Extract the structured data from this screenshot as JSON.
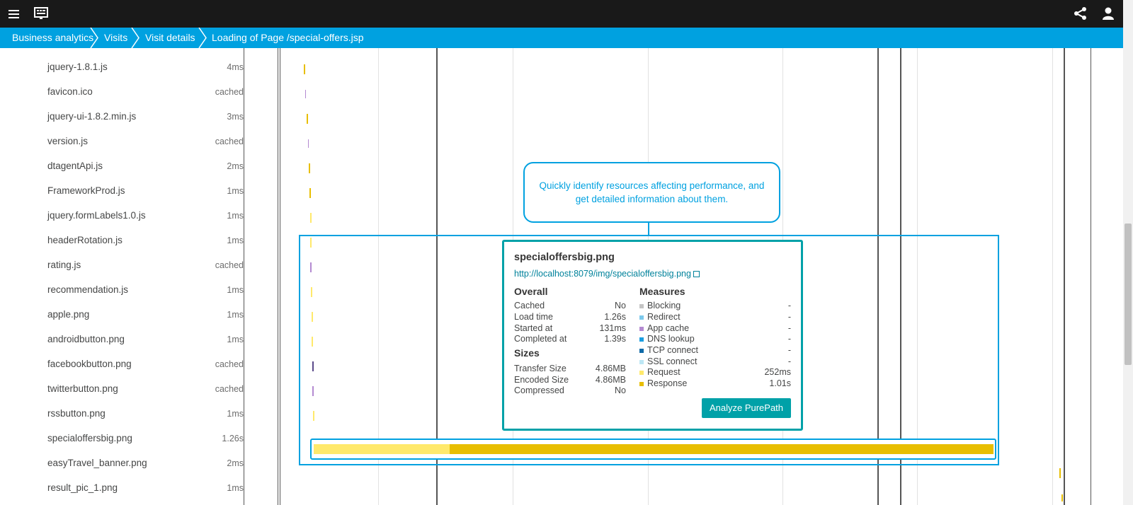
{
  "topbar": {
    "menu_icon": "hamburger-icon",
    "monitor_icon": "monitor-icon",
    "share_icon": "share-icon",
    "user_icon": "user-icon"
  },
  "breadcrumb": [
    {
      "label": "Business analytics"
    },
    {
      "label": "Visits"
    },
    {
      "label": "Visit details"
    },
    {
      "label": "Loading of Page /special-offers.jsp"
    }
  ],
  "resources": [
    {
      "name": "jquery-1.8.1.js",
      "duration": "4ms"
    },
    {
      "name": "favicon.ico",
      "duration": "cached"
    },
    {
      "name": "jquery-ui-1.8.2.min.js",
      "duration": "3ms"
    },
    {
      "name": "version.js",
      "duration": "cached"
    },
    {
      "name": "dtagentApi.js",
      "duration": "2ms"
    },
    {
      "name": "FrameworkProd.js",
      "duration": "1ms"
    },
    {
      "name": "jquery.formLabels1.0.js",
      "duration": "1ms"
    },
    {
      "name": "headerRotation.js",
      "duration": "1ms"
    },
    {
      "name": "rating.js",
      "duration": "cached"
    },
    {
      "name": "recommendation.js",
      "duration": "1ms"
    },
    {
      "name": "apple.png",
      "duration": "1ms"
    },
    {
      "name": "androidbutton.png",
      "duration": "1ms"
    },
    {
      "name": "facebookbutton.png",
      "duration": "cached"
    },
    {
      "name": "twitterbutton.png",
      "duration": "cached"
    },
    {
      "name": "rssbutton.png",
      "duration": "1ms"
    },
    {
      "name": "specialoffersbig.png",
      "duration": "1.26s"
    },
    {
      "name": "easyTravel_banner.png",
      "duration": "2ms"
    },
    {
      "name": "result_pic_1.png",
      "duration": "1ms"
    }
  ],
  "callout": {
    "line1": "Quickly identify resources affecting performance, and",
    "line2": "get detailed information about them."
  },
  "details": {
    "title": "specialoffersbig.png",
    "url": "http://localhost:8079/img/specialoffersbig.png",
    "overall_heading": "Overall",
    "overall": [
      {
        "label": "Cached",
        "value": "No"
      },
      {
        "label": "Load time",
        "value": "1.26s"
      },
      {
        "label": "Started at",
        "value": "131ms"
      },
      {
        "label": "Completed at",
        "value": "1.39s"
      }
    ],
    "sizes_heading": "Sizes",
    "sizes": [
      {
        "label": "Transfer Size",
        "value": "4.86MB"
      },
      {
        "label": "Encoded Size",
        "value": "4.86MB"
      },
      {
        "label": "Compressed",
        "value": "No"
      }
    ],
    "measures_heading": "Measures",
    "measures": [
      {
        "label": "Blocking",
        "value": "-",
        "color": "#c4c4c4"
      },
      {
        "label": "Redirect",
        "value": "-",
        "color": "#7dc9ec"
      },
      {
        "label": "App cache",
        "value": "-",
        "color": "#b48ad1"
      },
      {
        "label": "DNS lookup",
        "value": "-",
        "color": "#1b9ee0"
      },
      {
        "label": "TCP connect",
        "value": "-",
        "color": "#0f6aa7"
      },
      {
        "label": "SSL connect",
        "value": "-",
        "color": "#bde7f5"
      },
      {
        "label": "Request",
        "value": "252ms",
        "color": "#ffe96b"
      },
      {
        "label": "Response",
        "value": "1.01s",
        "color": "#e8be00"
      }
    ],
    "analyze_button": "Analyze PurePath"
  },
  "colors": {
    "topbar": "#191919",
    "breadcrumb": "#00a1e0",
    "accent": "#00a1a8",
    "request": "#ffe96b",
    "response": "#e8be00"
  }
}
